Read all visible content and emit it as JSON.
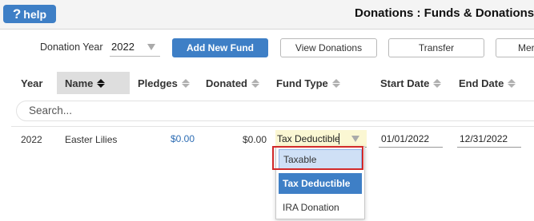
{
  "header": {
    "help_label": "help",
    "help_icon": "question-icon",
    "title": "Donations : Funds & Donations"
  },
  "toolbar": {
    "year_label": "Donation Year",
    "year_value": "2022",
    "add_fund_label": "Add New Fund",
    "view_donations_label": "View Donations",
    "transfer_label": "Transfer",
    "merge_label": "Mer"
  },
  "columns": {
    "year": "Year",
    "name": "Name",
    "pledges": "Pledges",
    "donated": "Donated",
    "fund_type": "Fund Type",
    "start_date": "Start Date",
    "end_date": "End Date"
  },
  "search": {
    "placeholder": "Search..."
  },
  "row": {
    "year": "2022",
    "name": "Easter Lilies",
    "pledges": "$0.00",
    "donated": "$0.00",
    "fund_type": "Tax Deductible",
    "start_date": "01/01/2022",
    "end_date": "12/31/2022"
  },
  "fund_type_options": [
    "Taxable",
    "Tax Deductible",
    "IRA Donation"
  ],
  "colors": {
    "accent": "#3e7fc6",
    "highlight": "#d22a2a",
    "hover_option": "#cfe0f6",
    "fund_type_bg": "#fbf7d3"
  }
}
